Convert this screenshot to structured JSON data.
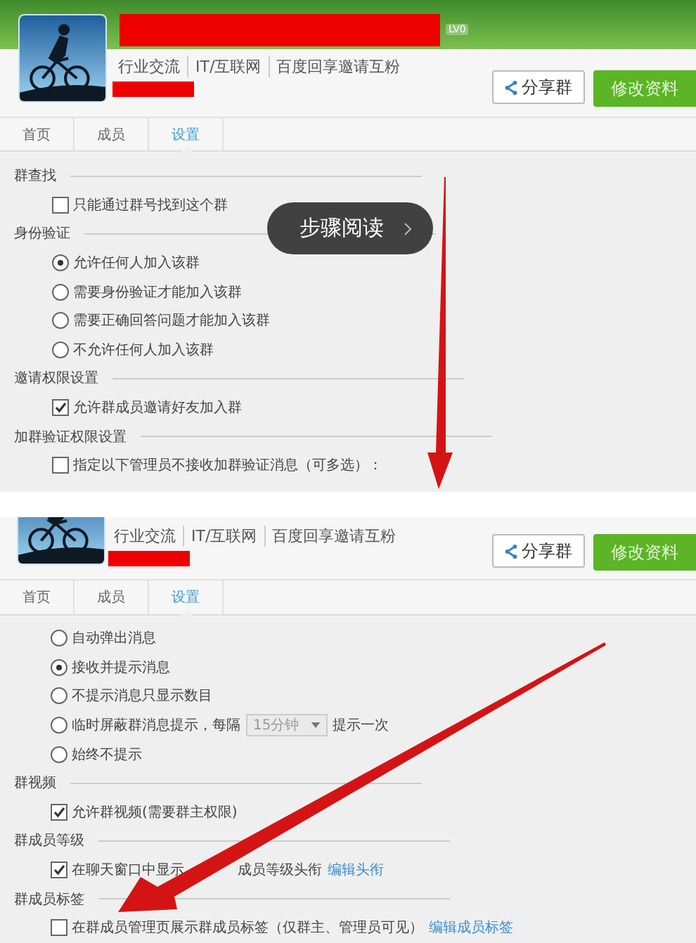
{
  "panels": [
    {
      "header": {
        "kind": "full",
        "badge": "LV0",
        "tags": [
          "行业交流",
          "IT/互联网",
          "百度回享邀请互粉"
        ],
        "share_button": "分享群",
        "edit_button": "修改资料"
      },
      "tabs": [
        {
          "label": "首页",
          "selected": false
        },
        {
          "label": "成员",
          "selected": false
        },
        {
          "label": "设置",
          "selected": true
        }
      ],
      "sections": [
        {
          "title": "群查找",
          "options": [
            {
              "kind": "checkbox",
              "label": "只能通过群号找到这个群",
              "checked": false
            }
          ]
        },
        {
          "title": "身份验证",
          "options": [
            {
              "kind": "radio",
              "label": "允许任何人加入该群",
              "selected": true
            },
            {
              "kind": "radio",
              "label": "需要身份验证才能加入该群",
              "selected": false
            },
            {
              "kind": "radio",
              "label": "需要正确回答问题才能加入该群",
              "selected": false
            },
            {
              "kind": "radio",
              "label": "不允许任何人加入该群",
              "selected": false
            }
          ]
        },
        {
          "title": "邀请权限设置",
          "options": [
            {
              "kind": "checkbox",
              "label": "允许群成员邀请好友加入群",
              "checked": true
            }
          ]
        },
        {
          "title": "加群验证权限设置",
          "options": [
            {
              "kind": "checkbox",
              "label": "指定以下管理员不接收加群验证消息（可多选）：",
              "checked": false
            }
          ]
        }
      ]
    },
    {
      "header": {
        "kind": "cropped",
        "tags": [
          "行业交流",
          "IT/互联网",
          "百度回享邀请互粉"
        ],
        "share_button": "分享群",
        "edit_button": "修改资料"
      },
      "tabs": [
        {
          "label": "首页",
          "selected": false
        },
        {
          "label": "成员",
          "selected": false
        },
        {
          "label": "设置",
          "selected": true
        }
      ],
      "sections": [
        {
          "options": [
            {
              "kind": "radio",
              "label": "自动弹出消息",
              "selected": false
            },
            {
              "kind": "radio",
              "label": "接收并提示消息",
              "selected": true
            },
            {
              "kind": "radio",
              "label": "不提示消息只显示数目",
              "selected": false
            },
            {
              "kind": "interval",
              "label": "临时屏蔽群消息提示，每隔",
              "select_value": "15分钟",
              "suffix": "提示一次",
              "selected": false
            },
            {
              "kind": "radio",
              "label": "始终不提示",
              "selected": false
            }
          ]
        },
        {
          "title": "群视频",
          "options": [
            {
              "kind": "checkbox",
              "label": "允许群视频(需要群主权限)",
              "checked": true
            }
          ]
        },
        {
          "title": "群成员等级",
          "options": [
            {
              "kind": "checkbox",
              "label": "在聊天窗口中显示",
              "label_after": "成员等级头衔",
              "checked": true,
              "link": "编辑头衔"
            }
          ]
        },
        {
          "title": "群成员标签",
          "options": [
            {
              "kind": "checkbox",
              "label": "在群成员管理页展示群成员标签（仅群主、管理员可见）",
              "checked": false,
              "link": "编辑成员标签"
            }
          ]
        }
      ]
    }
  ],
  "overlay": {
    "label": "步骤阅读"
  }
}
